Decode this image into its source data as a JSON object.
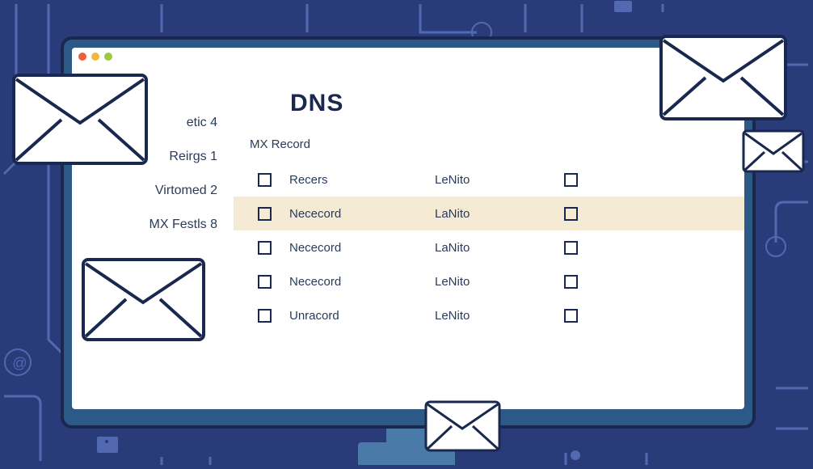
{
  "page_title": "DNS",
  "section_title": "MX Record",
  "sidebar": {
    "items": [
      {
        "label": "etic 4"
      },
      {
        "label": "Reirgs 1"
      },
      {
        "label": "Virtomed 2"
      },
      {
        "label": "MX Festls 8"
      }
    ]
  },
  "records": [
    {
      "name": "Recers",
      "value": "LeNito",
      "highlight": false
    },
    {
      "name": "Nececord",
      "value": "LaNito",
      "highlight": true
    },
    {
      "name": "Nececord",
      "value": "LaNito",
      "highlight": false
    },
    {
      "name": "Nececord",
      "value": "LeNito",
      "highlight": false
    },
    {
      "name": "Unracord",
      "value": "LeNito",
      "highlight": false
    }
  ]
}
